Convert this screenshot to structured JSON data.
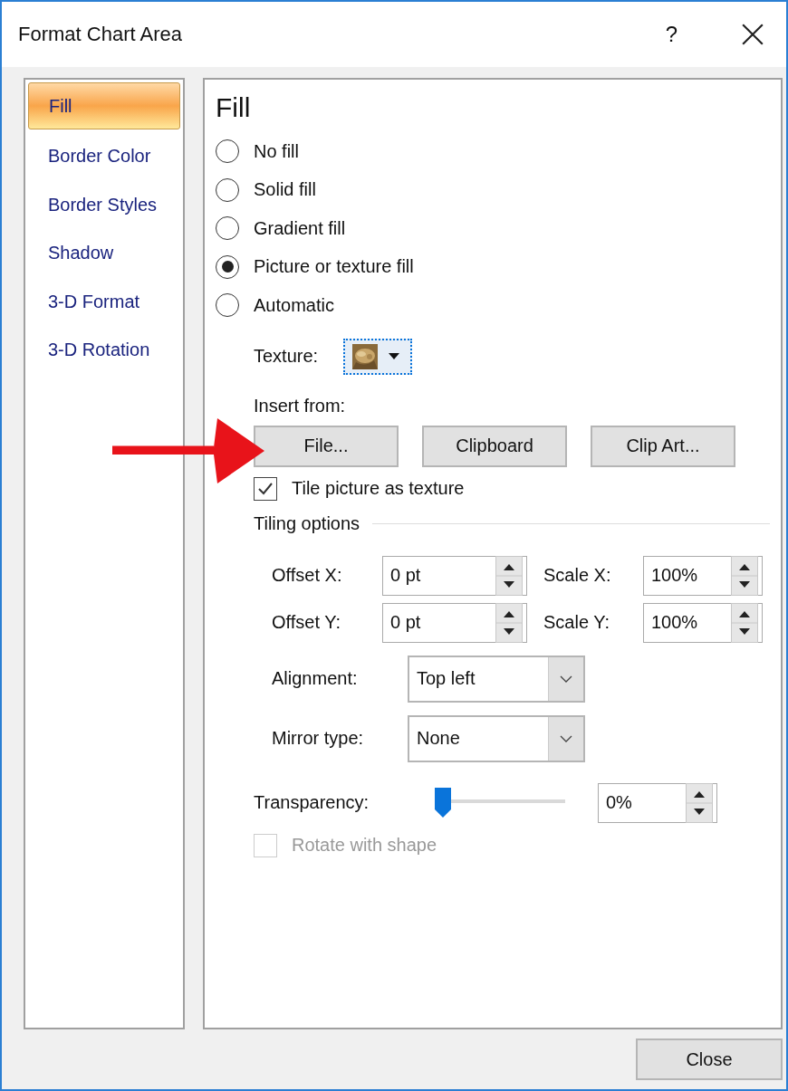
{
  "window": {
    "title": "Format Chart Area",
    "help_label": "?"
  },
  "sidebar": {
    "items": [
      {
        "label": "Fill",
        "selected": true
      },
      {
        "label": "Border Color",
        "selected": false
      },
      {
        "label": "Border Styles",
        "selected": false
      },
      {
        "label": "Shadow",
        "selected": false
      },
      {
        "label": "3-D Format",
        "selected": false
      },
      {
        "label": "3-D Rotation",
        "selected": false
      }
    ]
  },
  "panel": {
    "title": "Fill",
    "fill_options": [
      {
        "label": "No fill",
        "selected": false
      },
      {
        "label": "Solid fill",
        "selected": false
      },
      {
        "label": "Gradient fill",
        "selected": false
      },
      {
        "label": "Picture or texture fill",
        "selected": true
      },
      {
        "label": "Automatic",
        "selected": false
      }
    ],
    "texture": {
      "label": "Texture:"
    },
    "insert_from": {
      "label": "Insert from:",
      "buttons": [
        "File...",
        "Clipboard",
        "Clip Art..."
      ]
    },
    "tile_checkbox": {
      "label": "Tile picture as texture",
      "checked": true,
      "disabled": false
    },
    "tiling_options": {
      "title": "Tiling options",
      "fields": [
        {
          "label": "Offset X:",
          "value": "0 pt"
        },
        {
          "label": "Scale X:",
          "value": "100%"
        },
        {
          "label": "Offset Y:",
          "value": "0 pt"
        },
        {
          "label": "Scale Y:",
          "value": "100%"
        }
      ],
      "dropdowns": [
        {
          "label": "Alignment:",
          "value": "Top left"
        },
        {
          "label": "Mirror type:",
          "value": "None"
        }
      ]
    },
    "transparency": {
      "label": "Transparency:",
      "level": 0,
      "value": "0%"
    },
    "rotate_checkbox": {
      "label": "Rotate with shape",
      "checked": false,
      "disabled": true
    }
  },
  "footer": {
    "close_button": "Close"
  }
}
